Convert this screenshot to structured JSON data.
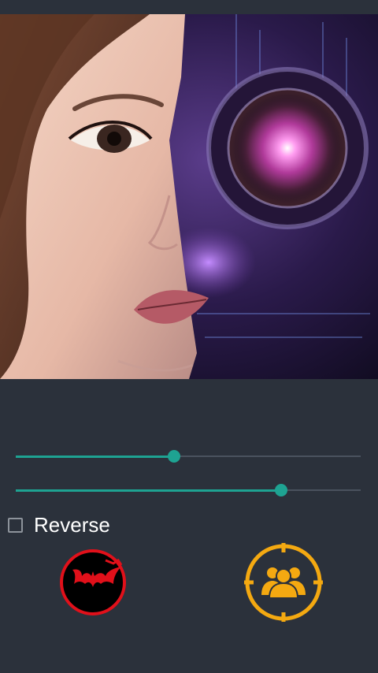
{
  "colors": {
    "accent": "#1ea392",
    "background": "#2b313b",
    "bat_button": "#e1101a",
    "group_button": "#f4a911"
  },
  "sliders": [
    {
      "name": "blend-slider",
      "value": 0.46
    },
    {
      "name": "opacity-slider",
      "value": 0.77
    }
  ],
  "reverse": {
    "label": "Reverse",
    "checked": false
  },
  "buttons": {
    "effect_icon": "bat-icon",
    "faces_icon": "group-target-icon"
  }
}
